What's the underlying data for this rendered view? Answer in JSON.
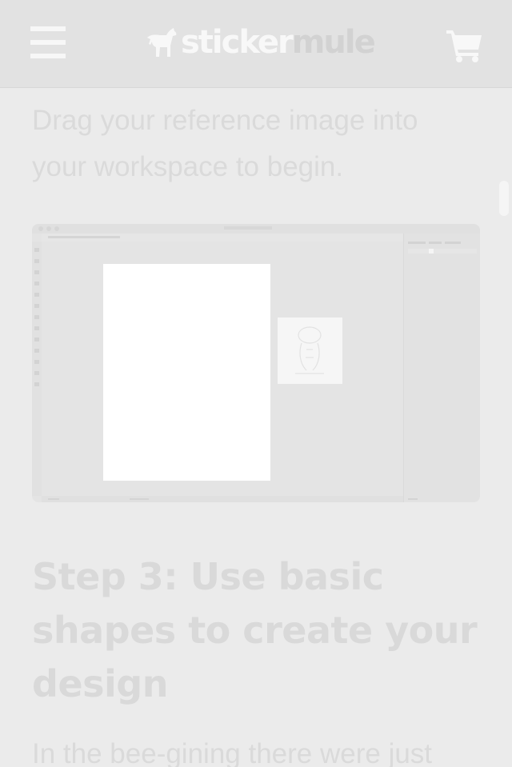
{
  "header": {
    "logo_sticker": "sticker",
    "logo_mule": "mule",
    "menu_icon": "hamburger-menu-icon",
    "logo_icon": "mule-logo-icon",
    "cart_icon": "shopping-cart-icon"
  },
  "article": {
    "intro_text": "Drag your reference image into your workspace to begin.",
    "step_heading": "Step 3: Use basic shapes to create your design",
    "paragraph_text": "In the bee-gining there were just"
  },
  "colors": {
    "header_bg": "#e2e2e2",
    "page_bg": "#ebebeb",
    "logo_sticker": "#f8f8f8",
    "logo_mule": "#d2d2d2",
    "text": "#dadada"
  }
}
